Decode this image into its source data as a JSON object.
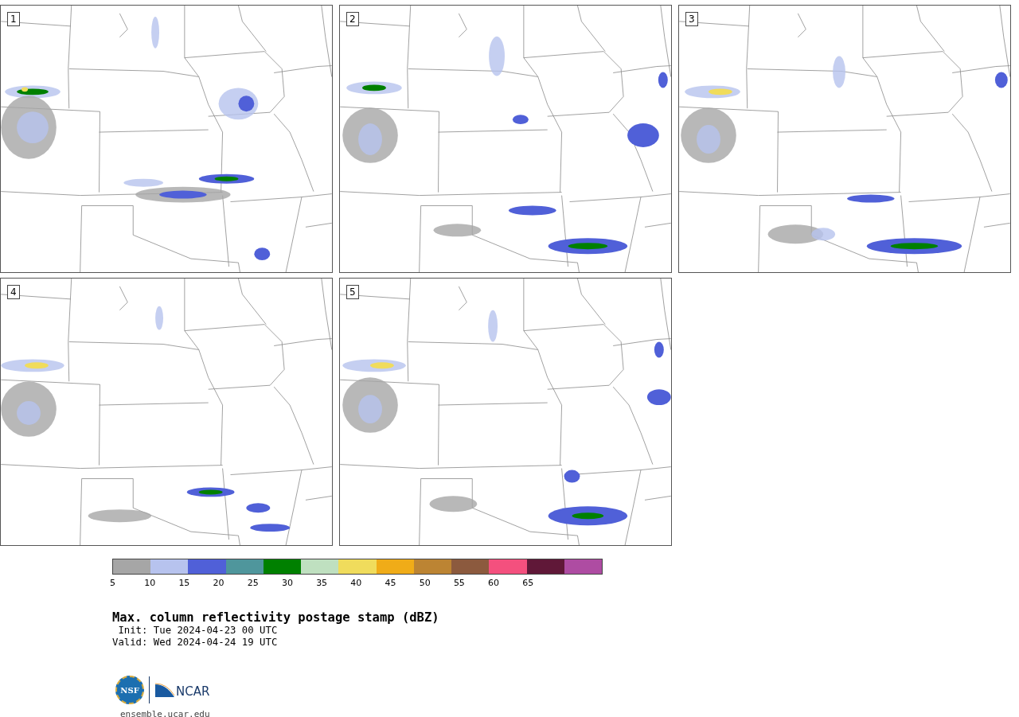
{
  "panels": [
    {
      "number": "1"
    },
    {
      "number": "2"
    },
    {
      "number": "3"
    },
    {
      "number": "4"
    },
    {
      "number": "5"
    }
  ],
  "colorbar": {
    "segments": [
      {
        "color": "#a6a6a6"
      },
      {
        "color": "#b7c3ee"
      },
      {
        "color": "#5060d8"
      },
      {
        "color": "#4f969c"
      },
      {
        "color": "#008000"
      },
      {
        "color": "#bfe0c0"
      },
      {
        "color": "#f0dc5c"
      },
      {
        "color": "#f0ac18"
      },
      {
        "color": "#bc8433"
      },
      {
        "color": "#8c5a3e"
      },
      {
        "color": "#f4507e"
      },
      {
        "color": "#601838"
      },
      {
        "color": "#ae4ca2"
      }
    ],
    "ticks": [
      "5",
      "10",
      "15",
      "20",
      "25",
      "30",
      "35",
      "40",
      "45",
      "50",
      "55",
      "60",
      "65"
    ]
  },
  "title": "Max. column reflectivity postage stamp (dBZ)",
  "init": " Init: Tue 2024-04-23 00 UTC",
  "valid": "Valid: Wed 2024-04-24 19 UTC",
  "logos": {
    "nsf": "NSF",
    "ncar": "NCAR"
  },
  "footer": "ensemble.ucar.edu"
}
